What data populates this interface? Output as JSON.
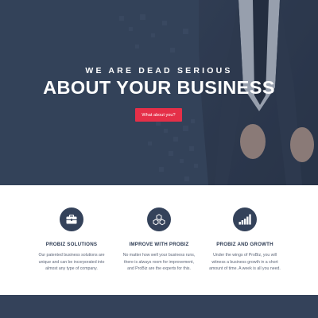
{
  "hero": {
    "kicker": "WE ARE DEAD SERIOUS",
    "headline": "ABOUT YOUR BUSINESS",
    "cta_label": "What about you?"
  },
  "features": [
    {
      "icon": "briefcase-icon",
      "title": "PROBIZ SOLUTIONS",
      "desc_lines": [
        "Our patented business solutions are",
        "unique and can be incorporated into",
        "almost any type of company."
      ]
    },
    {
      "icon": "cubes-icon",
      "title": "IMPROVE WITH PROBIZ",
      "desc_lines": [
        "No matter how well your business runs,",
        "there is always room for improvement,",
        "and ProBiz are the experts for this."
      ]
    },
    {
      "icon": "bar-chart-icon",
      "title": "PROBIZ AND GROWTH",
      "desc_lines": [
        "Under the wings of ProBiz, you will",
        "witness a business growth in a short",
        "amount of time. A week is all you need."
      ]
    }
  ],
  "colors": {
    "navy": "#34425a",
    "accent": "#e52f48",
    "text_dark": "#2c3a52",
    "text_body": "#5d6678"
  }
}
